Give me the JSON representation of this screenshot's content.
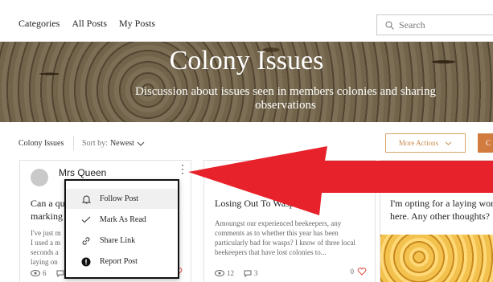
{
  "nav": {
    "links": [
      "Categories",
      "All Posts",
      "My Posts"
    ],
    "search_placeholder": "Search"
  },
  "hero": {
    "title": "Colony Issues",
    "subtitle": "Discussion about issues seen in members colonies and sharing observations"
  },
  "toolbar": {
    "breadcrumb": "Colony Issues",
    "sort_label": "Sort by:",
    "sort_value": "Newest",
    "more_actions": "More Actions",
    "orange_button_partial": "C"
  },
  "cards": [
    {
      "author": "Mrs Queen",
      "title_partial": "Can a qu\nmarking",
      "body_partial": "I've just m\nI used a m\nseconds a\nlaying on",
      "views": "6",
      "comments": "0",
      "likes": "0"
    },
    {
      "title": "Losing Out To Wasps?",
      "body": "Amoungst our experienced beekeepers, any comments as to whether this year has been particularly bad for wasps? I know of three local beekeepers that have lost colonies to...",
      "views": "12",
      "comments": "3",
      "likes": "0"
    },
    {
      "title": "I'm opting for a laying work here. Any other thoughts?"
    }
  ],
  "menu": {
    "items": [
      {
        "label": "Follow Post",
        "icon": "bell-icon"
      },
      {
        "label": "Mark As Read",
        "icon": "check-icon"
      },
      {
        "label": "Share Link",
        "icon": "link-icon"
      },
      {
        "label": "Report Post",
        "icon": "report-icon"
      }
    ]
  },
  "colors": {
    "accent": "#d27b3e",
    "annotation_arrow": "#e8222b"
  }
}
